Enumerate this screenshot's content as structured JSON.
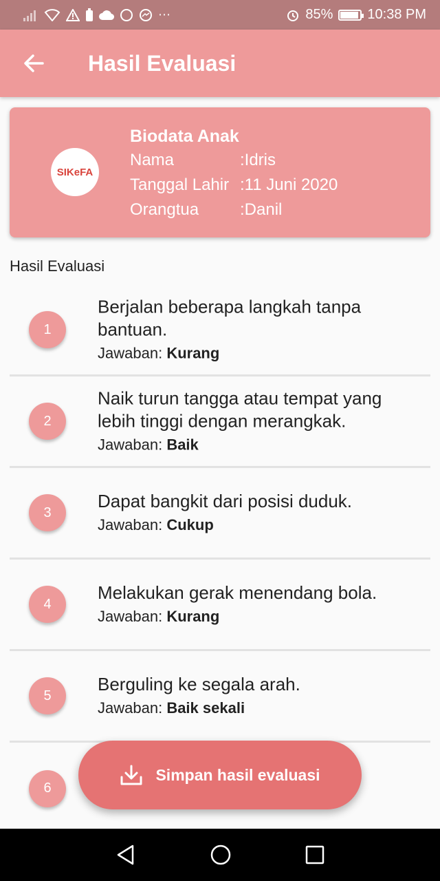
{
  "status_bar": {
    "left_icons": [
      "signal-icon",
      "wifi-icon",
      "warning-icon",
      "battery-saver-icon",
      "cloud-icon",
      "whatsapp-icon",
      "messenger-icon",
      "more-icon"
    ],
    "alarm_icon": "alarm-icon",
    "battery_percent": "85%",
    "time": "10:38 PM"
  },
  "app_bar": {
    "title": "Hasil Evaluasi",
    "back_icon": "arrow-left-icon"
  },
  "biodata": {
    "logo_text": "SIKeFA",
    "title": "Biodata Anak",
    "rows": [
      {
        "label": "Nama",
        "value": ":Idris"
      },
      {
        "label": "Tanggal Lahir",
        "value": ":11 Juni 2020"
      },
      {
        "label": "Orangtua",
        "value": ":Danil"
      }
    ]
  },
  "section_label": "Hasil Evaluasi",
  "answer_prefix": "Jawaban:",
  "evaluations": [
    {
      "number": "1",
      "question": "Berjalan beberapa langkah tanpa bantuan.",
      "answer": "Kurang"
    },
    {
      "number": "2",
      "question": "Naik turun tangga atau tempat yang lebih tinggi dengan merangkak.",
      "answer": "Baik"
    },
    {
      "number": "3",
      "question": "Dapat bangkit dari posisi duduk.",
      "answer": "Cukup"
    },
    {
      "number": "4",
      "question": "Melakukan gerak menendang bola.",
      "answer": "Kurang"
    },
    {
      "number": "5",
      "question": "Berguling ke segala arah.",
      "answer": "Baik sekali"
    },
    {
      "number": "6",
      "question": "",
      "answer": ""
    }
  ],
  "fab": {
    "label": "Simpan hasil evaluasi",
    "icon": "download-icon"
  },
  "nav_bar": {
    "buttons": [
      "back-triangle-icon",
      "home-circle-icon",
      "recents-square-icon"
    ]
  },
  "colors": {
    "primary": "#ee9a9a",
    "fab": "#e57373",
    "status_bar": "#b47c7c"
  }
}
